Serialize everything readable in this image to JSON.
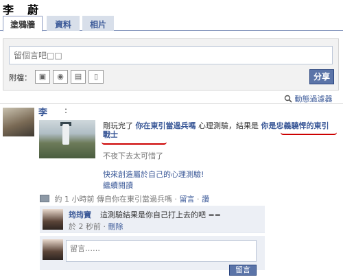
{
  "profile": {
    "name": "李　蔚"
  },
  "tabs": [
    {
      "label": "塗鴉牆",
      "active": true
    },
    {
      "label": "資料",
      "active": false
    },
    {
      "label": "相片",
      "active": false
    }
  ],
  "composer": {
    "placeholder": "留個言吧□□",
    "attach_label": "附檔：",
    "attach_icons": [
      "photo-icon",
      "video-icon",
      "gift-icon",
      "link-icon"
    ],
    "share_label": "分享"
  },
  "filter": {
    "label": "動態過濾器",
    "icon": "magnifier-icon"
  },
  "story": {
    "author": "李",
    "colon": ":",
    "text_prefix": "剛玩完了",
    "quiz_link": "你在東引當過兵嗎",
    "text_middle": "心理測驗，結果是",
    "result_link": "你是忠義驍悍的東引戰士",
    "subtitle": "不夜下去太可惜了",
    "cta": "快來創造屬於自己的心理測驗!",
    "more": "繼續閱讀",
    "meta_prefix": "約",
    "meta_time": "1 小時前",
    "meta_via": "傳自你在東引當過兵嗎",
    "meta_comment": "留言",
    "meta_like": "讚"
  },
  "comment": {
    "author": "筠筠寶",
    "text": "這測驗結果是你自己打上去的吧 ==",
    "time": "於 2 秒前",
    "delete": "刪除"
  },
  "reply": {
    "placeholder": "留言……",
    "button": "留言"
  },
  "colors": {
    "brand_blue": "#3b5998",
    "button_blue": "#5b74a8",
    "annotation_red": "#cc0000"
  }
}
